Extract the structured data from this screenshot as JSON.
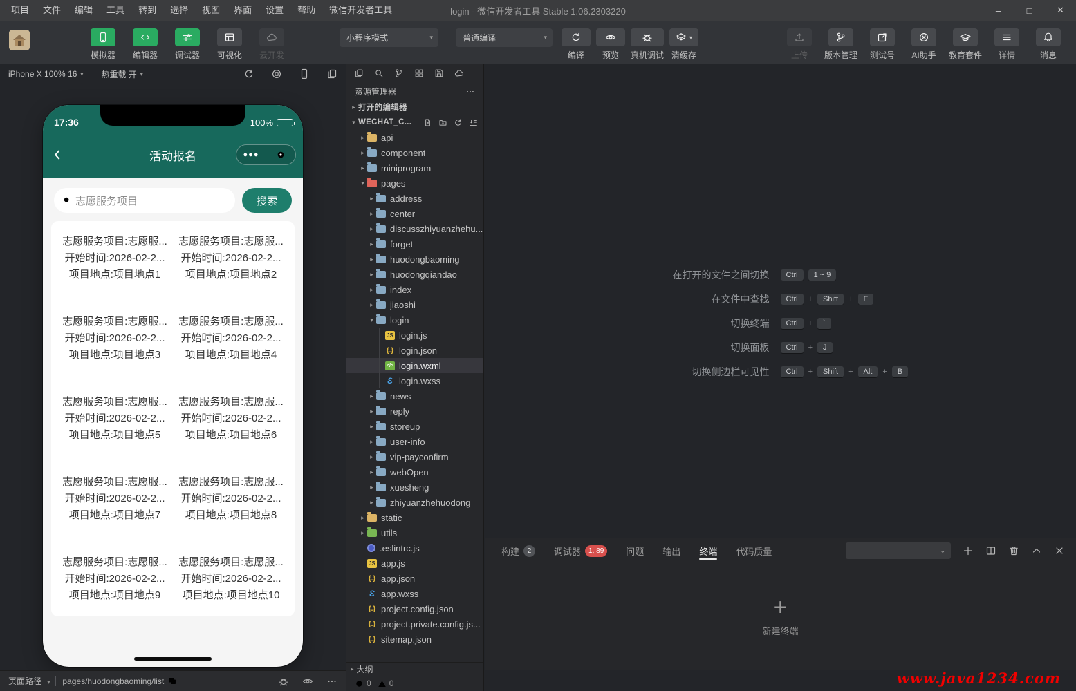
{
  "window": {
    "menus": [
      "项目",
      "文件",
      "编辑",
      "工具",
      "转到",
      "选择",
      "视图",
      "界面",
      "设置",
      "帮助",
      "微信开发者工具"
    ],
    "title": "login - 微信开发者工具 Stable 1.06.2303220",
    "controls": {
      "minimize": "–",
      "maximize": "□",
      "close": "✕"
    }
  },
  "toolbar": {
    "main_buttons": [
      {
        "label": "模拟器",
        "icon": "phone",
        "style": "green"
      },
      {
        "label": "编辑器",
        "icon": "code",
        "style": "green"
      },
      {
        "label": "调试器",
        "icon": "sliders",
        "style": "green"
      },
      {
        "label": "可视化",
        "icon": "grid",
        "style": "gray"
      },
      {
        "label": "云开发",
        "icon": "cloud",
        "style": "disabled"
      }
    ],
    "mode_select": "小程序模式",
    "compile_select": "普通编译",
    "action_buttons": [
      {
        "label": "编译",
        "icon": "refresh"
      },
      {
        "label": "预览",
        "icon": "eye"
      },
      {
        "label": "真机调试",
        "icon": "bug"
      },
      {
        "label": "清缓存",
        "icon": "layers",
        "caret": true
      }
    ],
    "right_buttons": [
      {
        "label": "上传",
        "icon": "upload",
        "disabled": true
      },
      {
        "label": "版本管理",
        "icon": "branch"
      },
      {
        "label": "测试号",
        "icon": "external"
      },
      {
        "label": "AI助手",
        "icon": "ai"
      },
      {
        "label": "教育套件",
        "icon": "cap"
      },
      {
        "label": "详情",
        "icon": "menu"
      },
      {
        "label": "消息",
        "icon": "bell"
      }
    ]
  },
  "simulator": {
    "device": "iPhone X 100% 16",
    "hot_reload": "热重载 开",
    "phone": {
      "time": "17:36",
      "battery": "100%",
      "nav_title": "活动报名",
      "search_placeholder": "志愿服务项目",
      "search_button": "搜索",
      "items": [
        {
          "line1": "志愿服务项目:志愿服...",
          "line2": "开始时间:2026-02-2...",
          "line3": "项目地点:项目地点1"
        },
        {
          "line1": "志愿服务项目:志愿服...",
          "line2": "开始时间:2026-02-2...",
          "line3": "项目地点:项目地点2"
        },
        {
          "line1": "志愿服务项目:志愿服...",
          "line2": "开始时间:2026-02-2...",
          "line3": "项目地点:项目地点3"
        },
        {
          "line1": "志愿服务项目:志愿服...",
          "line2": "开始时间:2026-02-2...",
          "line3": "项目地点:项目地点4"
        },
        {
          "line1": "志愿服务项目:志愿服...",
          "line2": "开始时间:2026-02-2...",
          "line3": "项目地点:项目地点5"
        },
        {
          "line1": "志愿服务项目:志愿服...",
          "line2": "开始时间:2026-02-2...",
          "line3": "项目地点:项目地点6"
        },
        {
          "line1": "志愿服务项目:志愿服...",
          "line2": "开始时间:2026-02-2...",
          "line3": "项目地点:项目地点7"
        },
        {
          "line1": "志愿服务项目:志愿服...",
          "line2": "开始时间:2026-02-2...",
          "line3": "项目地点:项目地点8"
        },
        {
          "line1": "志愿服务项目:志愿服...",
          "line2": "开始时间:2026-02-2...",
          "line3": "项目地点:项目地点9"
        },
        {
          "line1": "志愿服务项目:志愿服...",
          "line2": "开始时间:2026-02-2...",
          "line3": "项目地点:项目地点10"
        }
      ]
    },
    "footer": {
      "path_label": "页面路径",
      "path": "pages/huodongbaoming/list"
    }
  },
  "explorer": {
    "title": "资源管理器",
    "project_actions": [
      "new-file",
      "new-folder",
      "refresh",
      "collapse"
    ],
    "mini_icons": [
      "files",
      "search",
      "branch",
      "structure",
      "save",
      "cloud"
    ],
    "tree": [
      {
        "label": "打开的编辑器",
        "indent": 0,
        "arrow": "right",
        "bold": true
      },
      {
        "label": "WECHAT_C...",
        "indent": 0,
        "arrow": "down",
        "bold": true,
        "actions": true
      },
      {
        "label": "api",
        "indent": 1,
        "arrow": "right",
        "icon": "folder-yellow"
      },
      {
        "label": "component",
        "indent": 1,
        "arrow": "right",
        "icon": "folder-blue"
      },
      {
        "label": "miniprogram",
        "indent": 1,
        "arrow": "right",
        "icon": "folder-blue"
      },
      {
        "label": "pages",
        "indent": 1,
        "arrow": "down",
        "icon": "folder-red"
      },
      {
        "label": "address",
        "indent": 2,
        "arrow": "right",
        "icon": "folder-blue"
      },
      {
        "label": "center",
        "indent": 2,
        "arrow": "right",
        "icon": "folder-blue"
      },
      {
        "label": "discusszhiyuanzhehu...",
        "indent": 2,
        "arrow": "right",
        "icon": "folder-blue"
      },
      {
        "label": "forget",
        "indent": 2,
        "arrow": "right",
        "icon": "folder-blue"
      },
      {
        "label": "huodongbaoming",
        "indent": 2,
        "arrow": "right",
        "icon": "folder-blue"
      },
      {
        "label": "huodongqiandao",
        "indent": 2,
        "arrow": "right",
        "icon": "folder-blue"
      },
      {
        "label": "index",
        "indent": 2,
        "arrow": "right",
        "icon": "folder-blue"
      },
      {
        "label": "jiaoshi",
        "indent": 2,
        "arrow": "right",
        "icon": "folder-blue"
      },
      {
        "label": "login",
        "indent": 2,
        "arrow": "down",
        "icon": "folder-blue"
      },
      {
        "label": "login.js",
        "indent": 3,
        "icon": "js",
        "guide": true
      },
      {
        "label": "login.json",
        "indent": 3,
        "icon": "json",
        "guide": true
      },
      {
        "label": "login.wxml",
        "indent": 3,
        "icon": "wxml",
        "guide": true,
        "selected": true
      },
      {
        "label": "login.wxss",
        "indent": 3,
        "icon": "wxss",
        "guide": true
      },
      {
        "label": "news",
        "indent": 2,
        "arrow": "right",
        "icon": "folder-blue"
      },
      {
        "label": "reply",
        "indent": 2,
        "arrow": "right",
        "icon": "folder-blue"
      },
      {
        "label": "storeup",
        "indent": 2,
        "arrow": "right",
        "icon": "folder-blue"
      },
      {
        "label": "user-info",
        "indent": 2,
        "arrow": "right",
        "icon": "folder-blue"
      },
      {
        "label": "vip-payconfirm",
        "indent": 2,
        "arrow": "right",
        "icon": "folder-blue"
      },
      {
        "label": "webOpen",
        "indent": 2,
        "arrow": "right",
        "icon": "folder-blue"
      },
      {
        "label": "xuesheng",
        "indent": 2,
        "arrow": "right",
        "icon": "folder-blue"
      },
      {
        "label": "zhiyuanzhehuodong",
        "indent": 2,
        "arrow": "right",
        "icon": "folder-blue"
      },
      {
        "label": "static",
        "indent": 1,
        "arrow": "right",
        "icon": "folder-yellow"
      },
      {
        "label": "utils",
        "indent": 1,
        "arrow": "right",
        "icon": "folder-green"
      },
      {
        "label": ".eslintrc.js",
        "indent": 1,
        "icon": "eslint"
      },
      {
        "label": "app.js",
        "indent": 1,
        "icon": "js"
      },
      {
        "label": "app.json",
        "indent": 1,
        "icon": "json"
      },
      {
        "label": "app.wxss",
        "indent": 1,
        "icon": "wxss"
      },
      {
        "label": "project.config.json",
        "indent": 1,
        "icon": "json"
      },
      {
        "label": "project.private.config.js...",
        "indent": 1,
        "icon": "json"
      },
      {
        "label": "sitemap.json",
        "indent": 1,
        "icon": "json"
      }
    ],
    "outline": "大纲",
    "errors": "0",
    "warnings": "0"
  },
  "editor": {
    "shortcuts": [
      {
        "label": "在打开的文件之间切换",
        "keys": [
          "Ctrl",
          "1 ~ 9"
        ],
        "plus": false
      },
      {
        "label": "在文件中查找",
        "keys": [
          "Ctrl",
          "Shift",
          "F"
        ],
        "plus": true
      },
      {
        "label": "切换终端",
        "keys": [
          "Ctrl",
          "`"
        ],
        "plus": true
      },
      {
        "label": "切换面板",
        "keys": [
          "Ctrl",
          "J"
        ],
        "plus": true
      },
      {
        "label": "切换侧边栏可见性",
        "keys": [
          "Ctrl",
          "Shift",
          "Alt",
          "B"
        ],
        "plus": true
      }
    ]
  },
  "panel": {
    "tabs": [
      {
        "label": "构建",
        "badge": "2",
        "badge_style": "gray"
      },
      {
        "label": "调试器",
        "badge": "1, 89",
        "badge_style": "red"
      },
      {
        "label": "问题"
      },
      {
        "label": "输出"
      },
      {
        "label": "终端",
        "active": true
      },
      {
        "label": "代码质量"
      }
    ],
    "new_terminal": "新建终端"
  },
  "watermark": "www.java1234.com",
  "colors": {
    "accent_green": "#2aab61",
    "phone_green": "#17695c",
    "badge_red": "#d8504d"
  }
}
